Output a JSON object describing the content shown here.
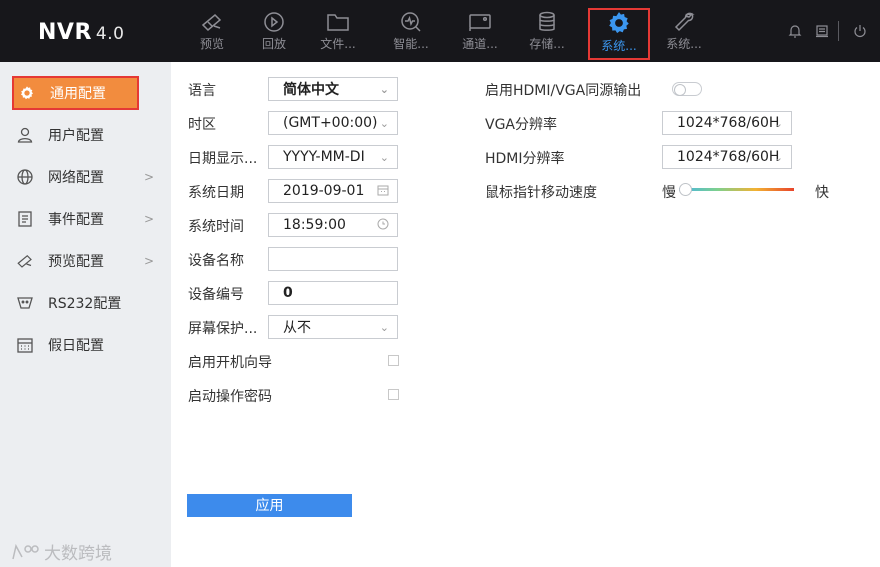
{
  "app": {
    "logo": "NVR",
    "version": "4.0"
  },
  "nav": [
    {
      "label": "预览",
      "icon": "camera-icon"
    },
    {
      "label": "回放",
      "icon": "play-circle-icon"
    },
    {
      "label": "文件...",
      "icon": "folder-icon"
    },
    {
      "label": "智能...",
      "icon": "smart-analysis-icon"
    },
    {
      "label": "通道...",
      "icon": "channel-icon"
    },
    {
      "label": "存储...",
      "icon": "database-icon"
    },
    {
      "label": "系统...",
      "icon": "gear-icon",
      "active": true
    },
    {
      "label": "系统...",
      "icon": "wrench-icon"
    }
  ],
  "top_right_icons": [
    "bell-icon",
    "monitor-icon",
    "power-icon"
  ],
  "sidebar": {
    "items": [
      {
        "label": "通用配置",
        "icon": "gear-icon",
        "active": true
      },
      {
        "label": "用户配置",
        "icon": "user-icon"
      },
      {
        "label": "网络配置",
        "icon": "globe-icon",
        "arrow": ">"
      },
      {
        "label": "事件配置",
        "icon": "event-icon",
        "arrow": ">"
      },
      {
        "label": "预览配置",
        "icon": "camera-icon",
        "arrow": ">"
      },
      {
        "label": "RS232配置",
        "icon": "rs232-icon"
      },
      {
        "label": "假日配置",
        "icon": "calendar-icon"
      }
    ]
  },
  "watermark": "大数跨境",
  "form": {
    "language": {
      "label": "语言",
      "value": "简体中文"
    },
    "timezone": {
      "label": "时区",
      "value": "(GMT+00:00)"
    },
    "date_format": {
      "label": "日期显示...",
      "value": "YYYY-MM-DI"
    },
    "system_date": {
      "label": "系统日期",
      "value": "2019-09-01"
    },
    "system_time": {
      "label": "系统时间",
      "value": "18:59:00"
    },
    "device_name": {
      "label": "设备名称",
      "value": ""
    },
    "device_number": {
      "label": "设备编号",
      "value": "0"
    },
    "screensaver": {
      "label": "屏幕保护...",
      "value": "从不"
    },
    "startup_wizard": {
      "label": "启用开机向导",
      "checked": false
    },
    "op_password": {
      "label": "启动操作密码",
      "checked": false
    },
    "hdmi_vga_same": {
      "label": "启用HDMI/VGA同源输出",
      "on": false
    },
    "vga_res": {
      "label": "VGA分辨率",
      "value": "1024*768/60H"
    },
    "hdmi_res": {
      "label": "HDMI分辨率",
      "value": "1024*768/60H"
    },
    "mouse_speed": {
      "label": "鼠标指针移动速度",
      "slow": "慢",
      "fast": "快",
      "level": 0
    },
    "apply": "应用"
  },
  "colors": {
    "topbar": "#17171b",
    "accent": "#3b96ef",
    "sidebar_active": "#f28c3e",
    "highlight_border": "#e53935",
    "button": "#3d8bec"
  }
}
